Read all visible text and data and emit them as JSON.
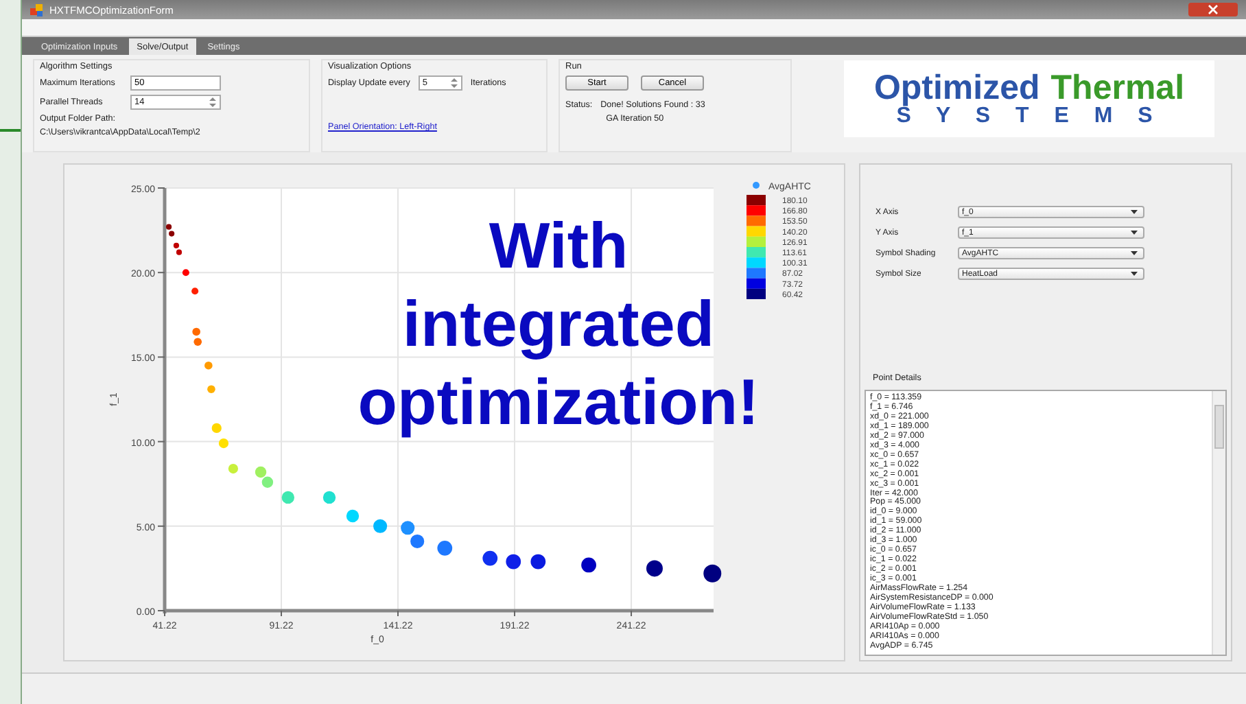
{
  "window": {
    "title": "HXTFMCOptimizationForm"
  },
  "tabs": [
    {
      "label": "Optimization Inputs",
      "selected": false
    },
    {
      "label": "Solve/Output",
      "selected": true
    },
    {
      "label": "Settings",
      "selected": false
    }
  ],
  "algorithm_settings": {
    "title": "Algorithm Settings",
    "maximum_iterations": {
      "label": "Maximum Iterations",
      "value": "50"
    },
    "parallel_threads": {
      "label": "Parallel Threads",
      "value": "14"
    },
    "output_folder": {
      "label": "Output Folder Path:",
      "value": "C:\\Users\\vikrantca\\AppData\\Local\\Temp\\2"
    }
  },
  "visualization_options": {
    "title": "Visualization Options",
    "display_update": {
      "label": "Display Update every",
      "value": "5",
      "suffix": "Iterations"
    },
    "panel_orientation_link": "Panel Orientation: Left-Right"
  },
  "run": {
    "title": "Run",
    "buttons": [
      "Start",
      "Cancel"
    ],
    "status_label": "Status:",
    "status_lines": [
      "Done! Solutions Found : 33",
      "GA Iteration 50"
    ]
  },
  "logo": {
    "word_1": "Optimized",
    "word_2": "Thermal",
    "word_3": "S Y S T E M S"
  },
  "overlay_caption": [
    "With",
    "integrated",
    "optimization!"
  ],
  "chart": {
    "chart_data": {
      "type": "scatter",
      "xlabel": "f_0",
      "ylabel": "f_1",
      "xlim": [
        41.22,
        276.5
      ],
      "ylim": [
        0,
        25
      ],
      "xticks": [
        41.22,
        91.22,
        141.22,
        191.22,
        241.22
      ],
      "yticks": [
        {
          "value": 0,
          "label": "0.00"
        },
        {
          "value": 5,
          "label": "5.00"
        },
        {
          "value": 10,
          "label": "10.00"
        },
        {
          "value": 15,
          "label": "15.00"
        },
        {
          "value": 20,
          "label": "20.00"
        },
        {
          "value": 25,
          "label": "25.00"
        }
      ],
      "x": [
        43.0,
        44.2,
        46.2,
        47.4,
        50.3,
        54.2,
        54.8,
        55.4,
        60.0,
        61.2,
        63.5,
        66.5,
        70.6,
        82.4,
        85.3,
        94.1,
        111.8,
        121.8,
        133.6,
        145.4,
        149.5,
        161.3,
        180.7,
        190.7,
        201.3,
        223.0,
        251.2,
        276.0
      ],
      "grid": true,
      "series": [
        {
          "name": "AvgAHTC",
          "color": "#3399ff",
          "values": [
            22.7,
            22.3,
            21.6,
            21.2,
            20.0,
            18.9,
            16.5,
            15.9,
            14.5,
            13.1,
            10.8,
            9.9,
            8.4,
            8.2,
            7.6,
            6.7,
            6.7,
            5.6,
            5.0,
            4.9,
            4.1,
            3.7,
            3.1,
            2.9,
            2.9,
            2.7,
            2.5,
            2.2
          ],
          "colors": [
            "#8b0000",
            "#8b0000",
            "#c00000",
            "#c00000",
            "#ff0000",
            "#ff2000",
            "#ff6a00",
            "#ff6a00",
            "#ff9a00",
            "#ffb000",
            "#ffd700",
            "#ffe000",
            "#c8f03c",
            "#a0f060",
            "#80f080",
            "#40e8b0",
            "#20e0d0",
            "#00d8ff",
            "#00b8ff",
            "#1e90ff",
            "#1e78ff",
            "#1e78ff",
            "#1030f0",
            "#1020e8",
            "#0a1ae0",
            "#0000c0",
            "#00008b",
            "#000080"
          ],
          "sizes": [
            0.1,
            0.1,
            0.1,
            0.1,
            0.15,
            0.15,
            0.2,
            0.2,
            0.2,
            0.2,
            0.3,
            0.3,
            0.3,
            0.4,
            0.4,
            0.5,
            0.5,
            0.5,
            0.6,
            0.6,
            0.6,
            0.7,
            0.7,
            0.7,
            0.7,
            0.7,
            0.85,
            1
          ]
        }
      ]
    },
    "colorbar": [
      {
        "label": "180.10",
        "color": "#8b0000"
      },
      {
        "label": "166.80",
        "color": "#ff0000"
      },
      {
        "label": "153.50",
        "color": "#ff6a00"
      },
      {
        "label": "140.20",
        "color": "#ffd700"
      },
      {
        "label": "126.91",
        "color": "#b4f03c"
      },
      {
        "label": "113.61",
        "color": "#40e8b0"
      },
      {
        "label": "100.31",
        "color": "#00d8ff"
      },
      {
        "label": "87.02",
        "color": "#1e78ff"
      },
      {
        "label": "73.72",
        "color": "#0000e0"
      },
      {
        "label": "60.42",
        "color": "#000080"
      }
    ]
  },
  "axis_options": [
    {
      "label": "X Axis",
      "value": "f_0"
    },
    {
      "label": "Y Axis",
      "value": "f_1"
    },
    {
      "label": "Symbol Shading",
      "value": "AvgAHTC"
    },
    {
      "label": "Symbol Size",
      "value": "HeatLoad"
    }
  ],
  "point_details": {
    "title": "Point Details",
    "lines": [
      "f_0 = 113.359",
      "f_1 = 6.746",
      "xd_0 = 221.000",
      "xd_1 = 189.000",
      "xd_2 = 97.000",
      "xd_3 = 4.000",
      "xc_0 = 0.657",
      "xc_1 = 0.022",
      "xc_2 = 0.001",
      "xc_3 = 0.001",
      "Iter = 42.000",
      "Pop = 45.000",
      "id_0 = 9.000",
      "id_1 = 59.000",
      "id_2 = 11.000",
      "id_3 = 1.000",
      "ic_0 = 0.657",
      "ic_1 = 0.022",
      "ic_2 = 0.001",
      "ic_3 = 0.001",
      "AirMassFlowRate = 1.254",
      "AirSystemResistanceDP = 0.000",
      "AirVolumeFlowRate = 1.133",
      "AirVolumeFlowRateStd = 1.050",
      "ARI410Ap = 0.000",
      "ARI410As = 0.000",
      "AvgADP = 6.745"
    ]
  }
}
